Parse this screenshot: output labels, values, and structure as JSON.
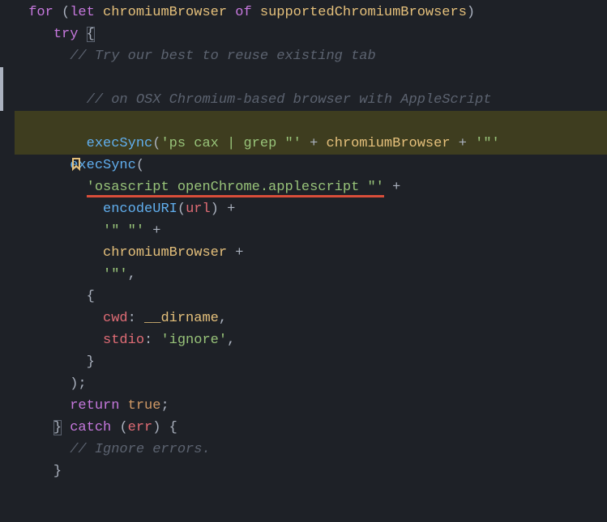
{
  "code": {
    "line1": {
      "for": "for",
      "paren1": " (",
      "let": "let",
      "sp1": " ",
      "var1": "chromiumBrowser",
      "sp2": " ",
      "of": "of",
      "sp3": " ",
      "var2": "supportedChromiumBrowsers",
      "paren2": ")"
    },
    "line2": {
      "indent": "    ",
      "try": "try",
      "sp": " ",
      "brace": "{"
    },
    "line3": {
      "indent": "      ",
      "comment": "// Try our best to reuse existing tab"
    },
    "line4": {
      "indent": "      ",
      "comment": "// on OSX Chromium-based browser with AppleScript"
    },
    "line5": {
      "indent": "      ",
      "fn": "execSync",
      "p1": "(",
      "str1": "'ps cax | grep \"'",
      "op1": " + ",
      "var1": "chromiumBrowser",
      "op2": " + ",
      "str2": "'\"'"
    },
    "line6": {
      "indent": "      ",
      "fn": "execSync",
      "p1": "("
    },
    "line7": {
      "indent": "        ",
      "str": "'osascript openChrome.applescript \"'",
      "op": " +"
    },
    "line8": {
      "indent": "          ",
      "fn": "encodeURI",
      "p1": "(",
      "var": "url",
      "p2": ")",
      "op": " +"
    },
    "line9": {
      "indent": "          ",
      "str": "'\" \"'",
      "op": " +"
    },
    "line10": {
      "indent": "          ",
      "var": "chromiumBrowser",
      "op": " +"
    },
    "line11": {
      "indent": "          ",
      "str": "'\"'",
      "comma": ","
    },
    "line12": {
      "indent": "        ",
      "brace": "{"
    },
    "line13": {
      "indent": "          ",
      "prop": "cwd",
      "colon": ": ",
      "var": "__dirname",
      "comma": ","
    },
    "line14": {
      "indent": "          ",
      "prop": "stdio",
      "colon": ": ",
      "str": "'ignore'",
      "comma": ","
    },
    "line15": {
      "indent": "        ",
      "brace": "}"
    },
    "line16": {
      "indent": "      ",
      "paren": ");"
    },
    "line17": {
      "indent": "      ",
      "return": "return",
      "sp": " ",
      "bool": "true",
      "semi": ";"
    },
    "line18": {
      "indent": "    ",
      "brace1": "}",
      "sp1": " ",
      "catch": "catch",
      "sp2": " ",
      "p1": "(",
      "err": "err",
      "p2": ")",
      "sp3": " ",
      "brace2": "{"
    },
    "line19": {
      "indent": "      ",
      "comment": "// Ignore errors."
    },
    "line20": {
      "indent": "    ",
      "brace": "}"
    }
  }
}
